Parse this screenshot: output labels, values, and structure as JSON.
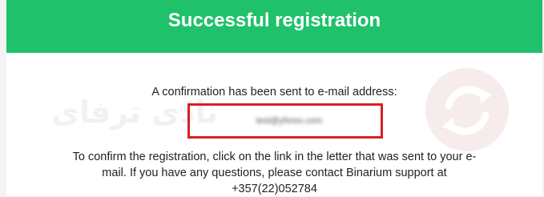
{
  "banner": {
    "title": "Successful registration"
  },
  "message": {
    "confirmation_line": "A confirmation has been sent to e-mail address:",
    "email": "test@yforex.com",
    "instructions": "To confirm the registration, click on the link in the letter that was sent to your e-mail. If you have any questions, please contact Binarium support at +357(22)052784"
  },
  "watermark": {
    "text": "نادی ترفای",
    "logo_icon": "circular-arrows-logo-icon"
  },
  "colors": {
    "banner_green": "#1fc16b",
    "highlight_red": "#d62020",
    "text": "#222222"
  }
}
